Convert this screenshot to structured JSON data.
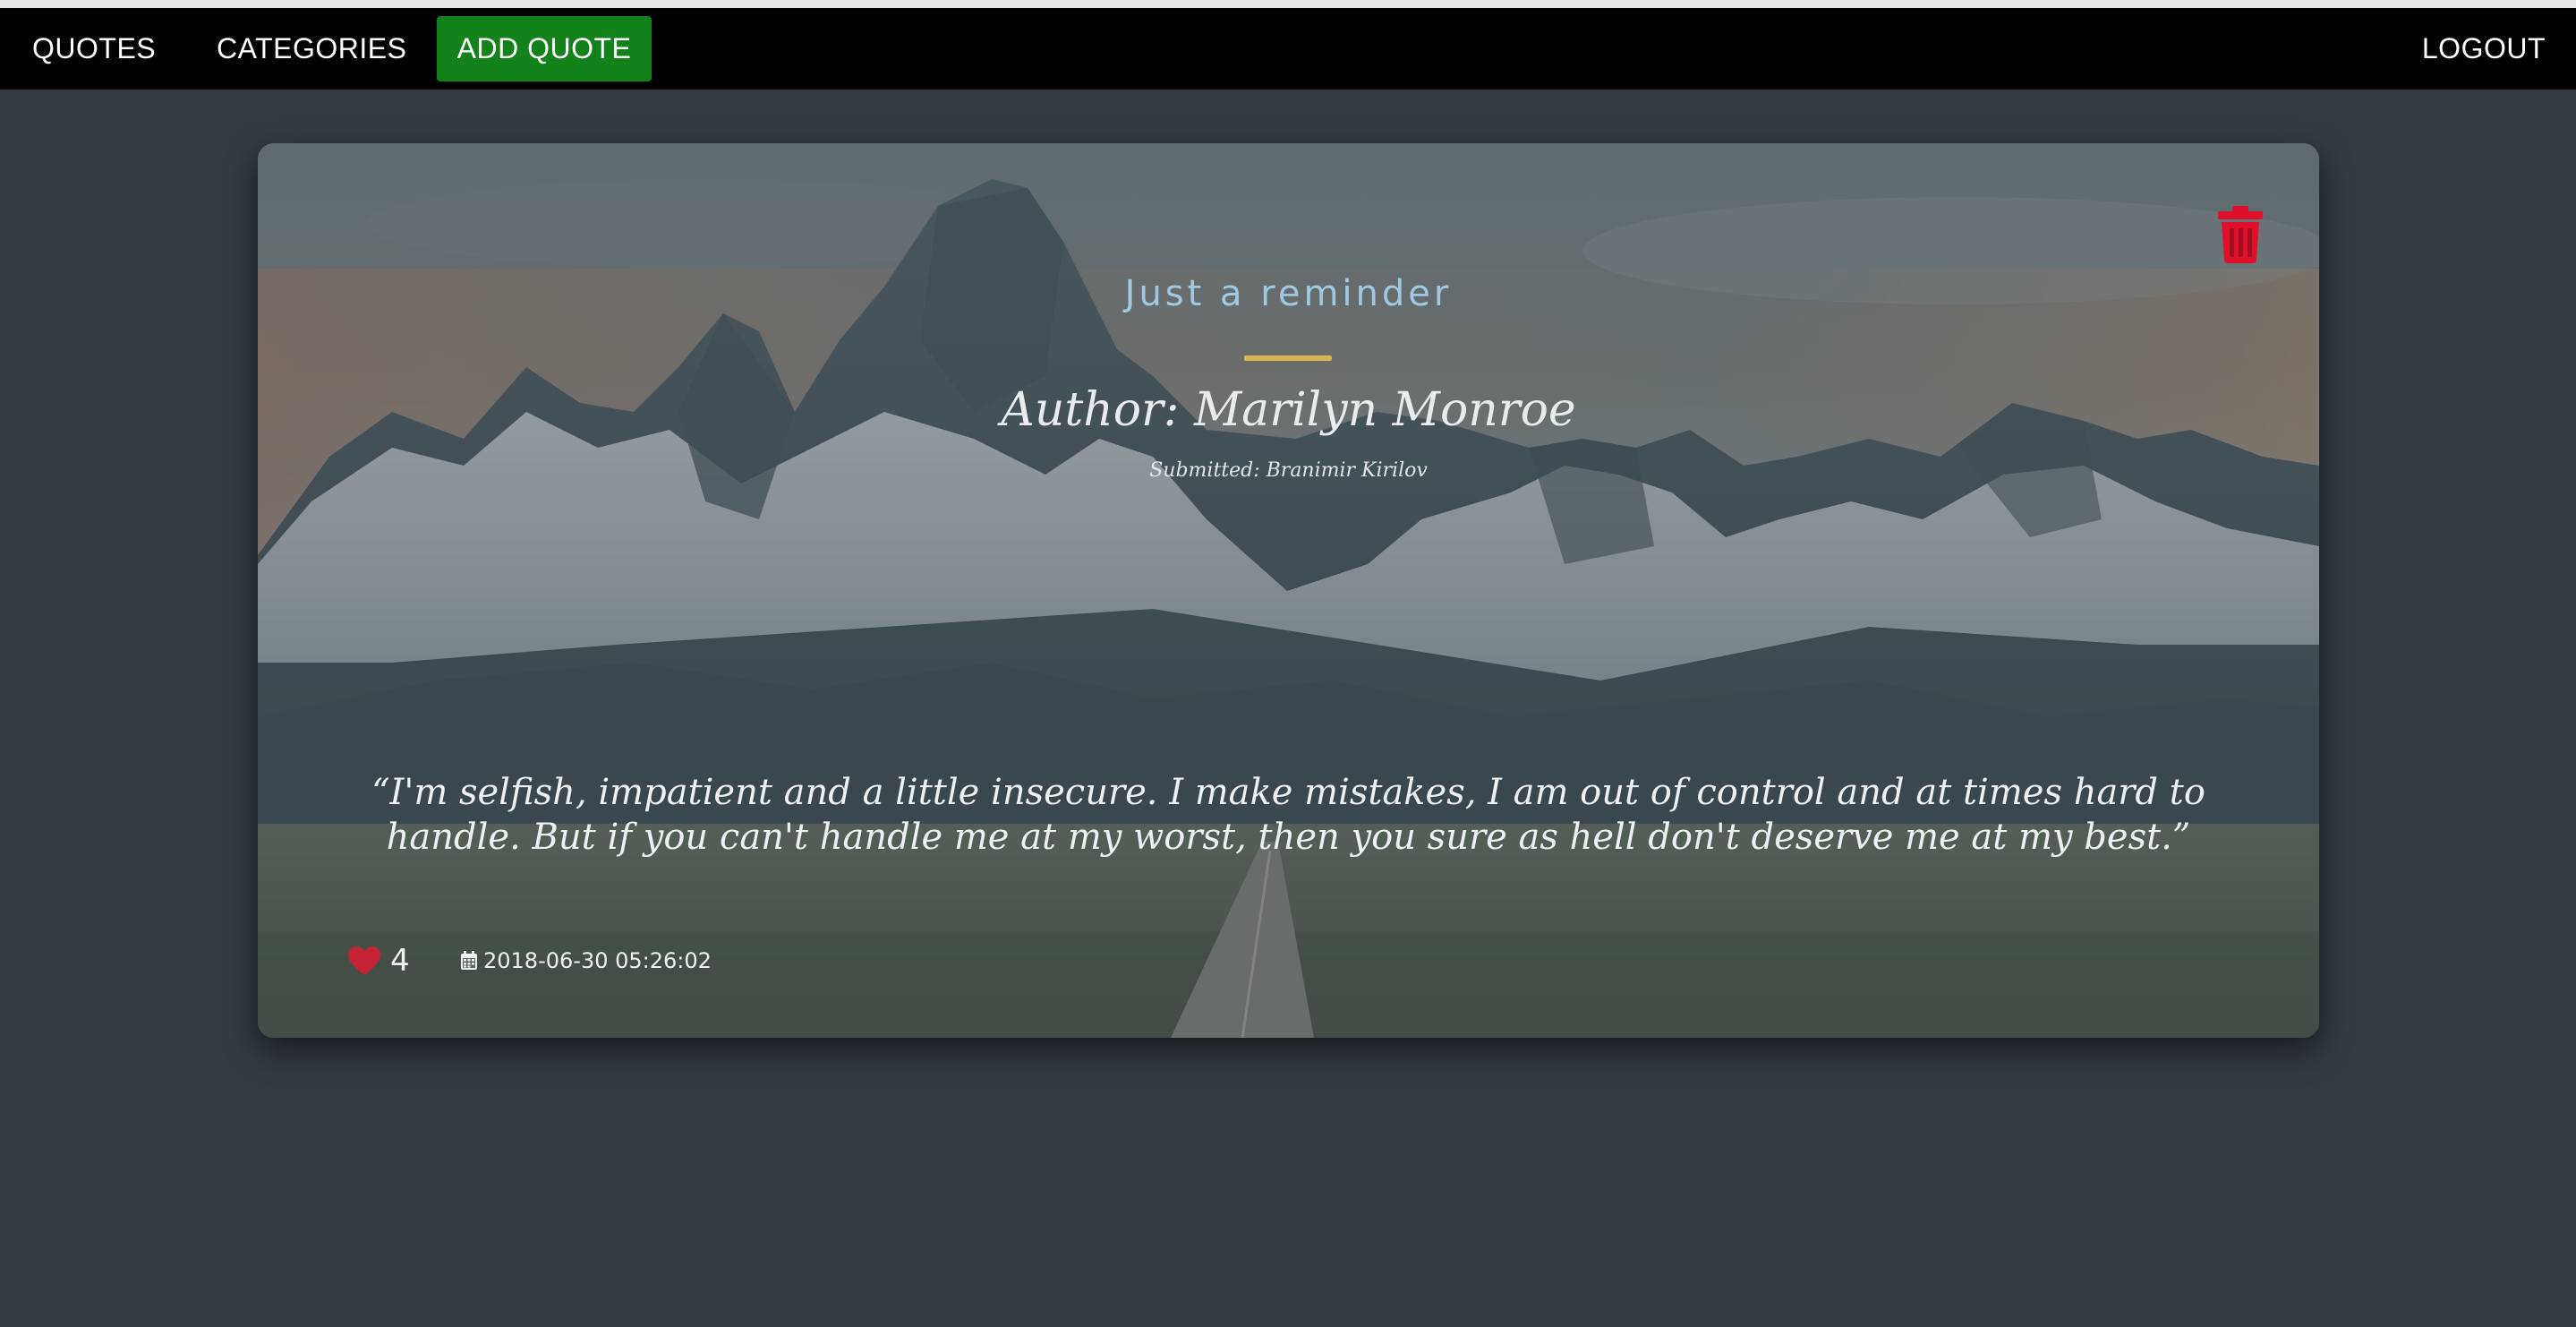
{
  "nav": {
    "quotes_label": "QUOTES",
    "categories_label": "CATEGORIES",
    "add_quote_label": "ADD QUOTE",
    "logout_label": "LOGOUT"
  },
  "quote_card": {
    "category": "Just a reminder",
    "author": "Author: Marilyn Monroe",
    "submitted": "Submitted: Branimir Kirilov",
    "text": "“I'm selfish, impatient and a little insecure. I make mistakes, I am out of control and at times hard to handle. But if you can't handle me at my worst, then you sure as hell don't deserve me at my best.”",
    "likes": "4",
    "date": "2018-06-30 05:26:02",
    "icons": {
      "delete": "trash-icon",
      "like": "heart-icon",
      "date": "calendar-icon",
      "background": "mountain-landscape-image"
    }
  },
  "colors": {
    "page_background": "#343b42",
    "navbar": "#000000",
    "add_button": "#14821a",
    "category_text": "#9fc8e2",
    "divider": "#d9b652",
    "delete_icon": "#e0102a",
    "heart_icon": "#c42434"
  }
}
